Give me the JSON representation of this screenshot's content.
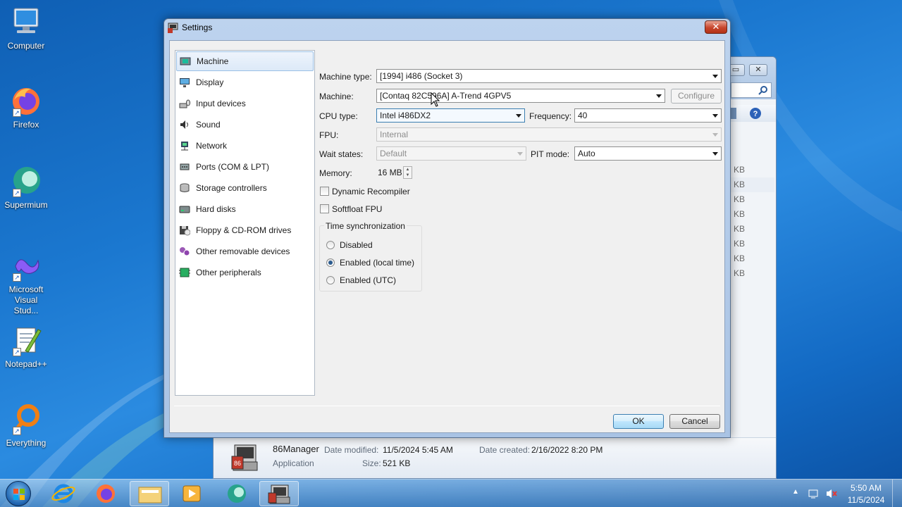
{
  "desktop": {
    "icons": [
      {
        "label": "Computer",
        "icon": "computer-icon"
      },
      {
        "label": "Firefox",
        "icon": "firefox-icon"
      },
      {
        "label": "Supermium",
        "icon": "supermium-icon"
      },
      {
        "label": "Microsoft Visual Stud...",
        "icon": "visual-studio-icon"
      },
      {
        "label": "Notepad++",
        "icon": "notepad-plus-plus-icon"
      },
      {
        "label": "Everything",
        "icon": "everything-search-icon"
      }
    ]
  },
  "explorer": {
    "list_sizes": [
      "KB",
      "KB",
      "KB",
      "KB",
      "KB",
      "KB",
      "KB",
      "KB"
    ],
    "details": {
      "name": "86Manager",
      "type": "Application",
      "date_modified_label": "Date modified:",
      "date_modified": "11/5/2024 5:45 AM",
      "date_created_label": "Date created:",
      "date_created": "2/16/2022 8:20 PM",
      "size_label": "Size:",
      "size": "521 KB"
    }
  },
  "dialog": {
    "title": "Settings",
    "categories": [
      {
        "label": "Machine",
        "icon": "machine-icon",
        "selected": true
      },
      {
        "label": "Display",
        "icon": "display-icon"
      },
      {
        "label": "Input devices",
        "icon": "input-devices-icon"
      },
      {
        "label": "Sound",
        "icon": "sound-icon"
      },
      {
        "label": "Network",
        "icon": "network-icon"
      },
      {
        "label": "Ports (COM & LPT)",
        "icon": "ports-icon"
      },
      {
        "label": "Storage controllers",
        "icon": "storage-controllers-icon"
      },
      {
        "label": "Hard disks",
        "icon": "hard-disk-icon"
      },
      {
        "label": "Floppy & CD-ROM drives",
        "icon": "floppy-cdrom-icon"
      },
      {
        "label": "Other removable devices",
        "icon": "removable-devices-icon"
      },
      {
        "label": "Other peripherals",
        "icon": "peripherals-icon"
      }
    ],
    "machine": {
      "machine_type_label": "Machine type:",
      "machine_type": "[1994] i486 (Socket 3)",
      "machine_label": "Machine:",
      "machine": "[Contaq 82C596A] A-Trend 4GPV5",
      "configure_label": "Configure",
      "cpu_type_label": "CPU type:",
      "cpu_type": "Intel i486DX2",
      "frequency_label": "Frequency:",
      "frequency": "40",
      "fpu_label": "FPU:",
      "fpu": "Internal",
      "wait_states_label": "Wait states:",
      "wait_states": "Default",
      "pit_mode_label": "PIT mode:",
      "pit_mode": "Auto",
      "memory_label": "Memory:",
      "memory": "16 MB",
      "dynamic_recompiler_label": "Dynamic Recompiler",
      "dynamic_recompiler": false,
      "softfloat_label": "Softfloat FPU",
      "softfloat": false,
      "time_sync": {
        "title": "Time synchronization",
        "options": [
          "Disabled",
          "Enabled (local time)",
          "Enabled (UTC)"
        ],
        "selected": "Enabled (local time)"
      }
    },
    "ok_label": "OK",
    "cancel_label": "Cancel"
  },
  "taskbar": {
    "time": "5:50 AM",
    "date": "11/5/2024",
    "pinned": [
      "internet-explorer-icon",
      "firefox-icon",
      "file-explorer-icon",
      "media-player-icon",
      "supermium-icon",
      "86box-manager-icon"
    ]
  },
  "colors": {
    "desktop_blue": "#1b78d0",
    "selection": "#dce9f8",
    "accent": "#3c7fb1"
  }
}
